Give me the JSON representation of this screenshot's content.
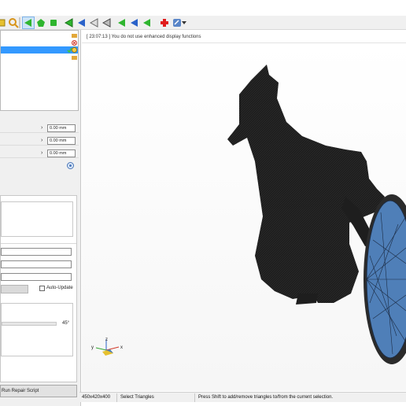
{
  "console": {
    "message": "[ 23:07:13 ] You do not use enhanced display functions"
  },
  "properties": {
    "rows": [
      {
        "value": "0.00 mm"
      },
      {
        "value": "0.00 mm"
      },
      {
        "value": "0.00 mm"
      }
    ]
  },
  "repair": {
    "auto_update_label": "Auto-Update",
    "angle_label": "45°",
    "run_script_label": "Run Repair Script"
  },
  "status_bar": {
    "dimensions": "450x420x400",
    "mode": "Select Triangles",
    "hint": "Press Shift to add/remove triangles to/from the current selection."
  },
  "axes": {
    "x": "x",
    "y": "y",
    "z": "z"
  },
  "colors": {
    "accent_select": "#3399ff",
    "model": "#1e1e1e",
    "disc": "#4f7fb8"
  }
}
